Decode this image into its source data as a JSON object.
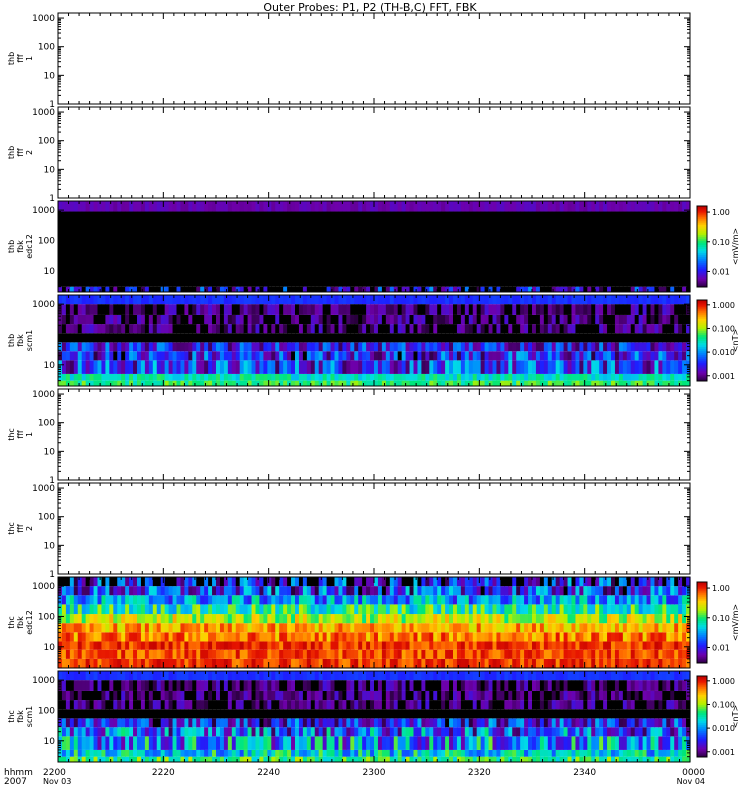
{
  "title": "Outer Probes: P1, P2 (TH-B,C) FFT, FBK",
  "time_axis": {
    "label_line1": "hhmm",
    "label_line2": "2007",
    "ticks": [
      {
        "t": 0,
        "label": "2200",
        "date": "Nov 03"
      },
      {
        "t": 20,
        "label": "2220",
        "date": ""
      },
      {
        "t": 40,
        "label": "2240",
        "date": ""
      },
      {
        "t": 60,
        "label": "2300",
        "date": ""
      },
      {
        "t": 80,
        "label": "2320",
        "date": ""
      },
      {
        "t": 100,
        "label": "2340",
        "date": ""
      },
      {
        "t": 120,
        "label": "0000",
        "date": "Nov 04"
      }
    ],
    "range_minutes": [
      0,
      120
    ]
  },
  "chart_data": [
    {
      "type": "line",
      "id": "thb-fff1",
      "ylabel_lines": [
        "thb",
        "fff",
        "1"
      ],
      "y_scale": "log",
      "ylim": [
        1,
        1500
      ],
      "y_ticks": [
        "1",
        "10",
        "100",
        "1000"
      ],
      "series": []
    },
    {
      "type": "line",
      "id": "thb-fff2",
      "ylabel_lines": [
        "thb",
        "fff",
        "2"
      ],
      "y_scale": "log",
      "ylim": [
        1,
        1500
      ],
      "y_ticks": [
        "1",
        "10",
        "100",
        "1000"
      ],
      "series": []
    },
    {
      "type": "heatmap",
      "id": "thb-fbk-edc12",
      "ylabel_lines": [
        "thb",
        "fbk",
        "edc12"
      ],
      "y_scale": "log",
      "ylim": [
        2,
        2000
      ],
      "y_ticks": [
        "10",
        "100",
        "1000"
      ],
      "colorbar": {
        "label": "<mV/m>",
        "ticks": [
          "0.01",
          "0.10",
          "1.00"
        ],
        "range": [
          0.003,
          1.6
        ]
      },
      "bands": [
        {
          "f_lo": 2,
          "f_hi": 3,
          "value": 0.004,
          "variability": 0.6
        },
        {
          "f_lo": 3,
          "f_hi": 900,
          "value": 0.0001,
          "variability": 0.0
        },
        {
          "f_lo": 900,
          "f_hi": 2000,
          "value": 0.006,
          "variability": 0.05
        }
      ]
    },
    {
      "type": "heatmap",
      "id": "thb-fbk-scm1",
      "ylabel_lines": [
        "thb",
        "fbk",
        "scm1"
      ],
      "y_scale": "log",
      "ylim": [
        2,
        2000
      ],
      "y_ticks": [
        "10",
        "1000"
      ],
      "colorbar": {
        "label": "<nT>",
        "ticks": [
          "0.001",
          "0.010",
          "0.100",
          "1.000"
        ],
        "range": [
          0.0006,
          1.6
        ]
      },
      "bands": [
        {
          "f_lo": 2,
          "f_hi": 3,
          "value": 0.05,
          "variability": 0.2
        },
        {
          "f_lo": 3,
          "f_hi": 5,
          "value": 0.03,
          "variability": 0.2
        },
        {
          "f_lo": 5,
          "f_hi": 14,
          "value": 0.004,
          "variability": 0.5
        },
        {
          "f_lo": 14,
          "f_hi": 28,
          "value": 0.003,
          "variability": 0.5
        },
        {
          "f_lo": 28,
          "f_hi": 55,
          "value": 0.003,
          "variability": 0.4
        },
        {
          "f_lo": 55,
          "f_hi": 110,
          "value": 0.0001,
          "variability": 0.2
        },
        {
          "f_lo": 110,
          "f_hi": 220,
          "value": 0.0008,
          "variability": 0.3
        },
        {
          "f_lo": 220,
          "f_hi": 440,
          "value": 0.0008,
          "variability": 0.3
        },
        {
          "f_lo": 440,
          "f_hi": 1000,
          "value": 0.0008,
          "variability": 0.3
        },
        {
          "f_lo": 1000,
          "f_hi": 2000,
          "value": 0.004,
          "variability": 0.05
        }
      ]
    },
    {
      "type": "line",
      "id": "thc-fff1",
      "ylabel_lines": [
        "thc",
        "fff",
        "1"
      ],
      "y_scale": "log",
      "ylim": [
        1,
        1500
      ],
      "y_ticks": [
        "1",
        "10",
        "100",
        "1000"
      ],
      "series": []
    },
    {
      "type": "line",
      "id": "thc-fff2",
      "ylabel_lines": [
        "thc",
        "fff",
        "2"
      ],
      "y_scale": "log",
      "ylim": [
        1,
        1500
      ],
      "y_ticks": [
        "1",
        "10",
        "100",
        "1000"
      ],
      "series": []
    },
    {
      "type": "heatmap",
      "id": "thc-fbk-edc12",
      "ylabel_lines": [
        "thc",
        "fbk",
        "edc12"
      ],
      "y_scale": "log",
      "ylim": [
        2,
        2000
      ],
      "y_ticks": [
        "10",
        "100",
        "1000"
      ],
      "colorbar": {
        "label": "<mV/m>",
        "ticks": [
          "0.01",
          "0.10",
          "1.00"
        ],
        "range": [
          0.003,
          1.6
        ]
      },
      "bands": [
        {
          "f_lo": 2,
          "f_hi": 4,
          "value": 0.9,
          "variability": 0.15
        },
        {
          "f_lo": 4,
          "f_hi": 8,
          "value": 0.8,
          "variability": 0.15
        },
        {
          "f_lo": 8,
          "f_hi": 15,
          "value": 0.9,
          "variability": 0.15
        },
        {
          "f_lo": 15,
          "f_hi": 30,
          "value": 0.6,
          "variability": 0.2
        },
        {
          "f_lo": 30,
          "f_hi": 60,
          "value": 0.45,
          "variability": 0.2
        },
        {
          "f_lo": 60,
          "f_hi": 120,
          "value": 0.2,
          "variability": 0.25
        },
        {
          "f_lo": 120,
          "f_hi": 250,
          "value": 0.08,
          "variability": 0.3
        },
        {
          "f_lo": 250,
          "f_hi": 500,
          "value": 0.03,
          "variability": 0.35
        },
        {
          "f_lo": 500,
          "f_hi": 1000,
          "value": 0.012,
          "variability": 0.45
        },
        {
          "f_lo": 1000,
          "f_hi": 2000,
          "value": 0.006,
          "variability": 0.6
        }
      ]
    },
    {
      "type": "heatmap",
      "id": "thc-fbk-scm1",
      "ylabel_lines": [
        "thc",
        "fbk",
        "scm1"
      ],
      "y_scale": "log",
      "ylim": [
        2,
        2000
      ],
      "y_ticks": [
        "10",
        "100",
        "1000"
      ],
      "colorbar": {
        "label": "<nT>",
        "ticks": [
          "0.001",
          "0.010",
          "0.100",
          "1.000"
        ],
        "range": [
          0.0006,
          1.6
        ]
      },
      "bands": [
        {
          "f_lo": 2,
          "f_hi": 3,
          "value": 0.05,
          "variability": 0.3
        },
        {
          "f_lo": 3,
          "f_hi": 5,
          "value": 0.02,
          "variability": 0.4
        },
        {
          "f_lo": 5,
          "f_hi": 14,
          "value": 0.01,
          "variability": 0.6
        },
        {
          "f_lo": 14,
          "f_hi": 28,
          "value": 0.006,
          "variability": 0.6
        },
        {
          "f_lo": 28,
          "f_hi": 55,
          "value": 0.003,
          "variability": 0.5
        },
        {
          "f_lo": 55,
          "f_hi": 110,
          "value": 0.0001,
          "variability": 0.2
        },
        {
          "f_lo": 110,
          "f_hi": 220,
          "value": 0.0008,
          "variability": 0.3
        },
        {
          "f_lo": 220,
          "f_hi": 440,
          "value": 0.0008,
          "variability": 0.3
        },
        {
          "f_lo": 440,
          "f_hi": 1000,
          "value": 0.0008,
          "variability": 0.3
        },
        {
          "f_lo": 1000,
          "f_hi": 2000,
          "value": 0.004,
          "variability": 0.05
        }
      ]
    }
  ]
}
